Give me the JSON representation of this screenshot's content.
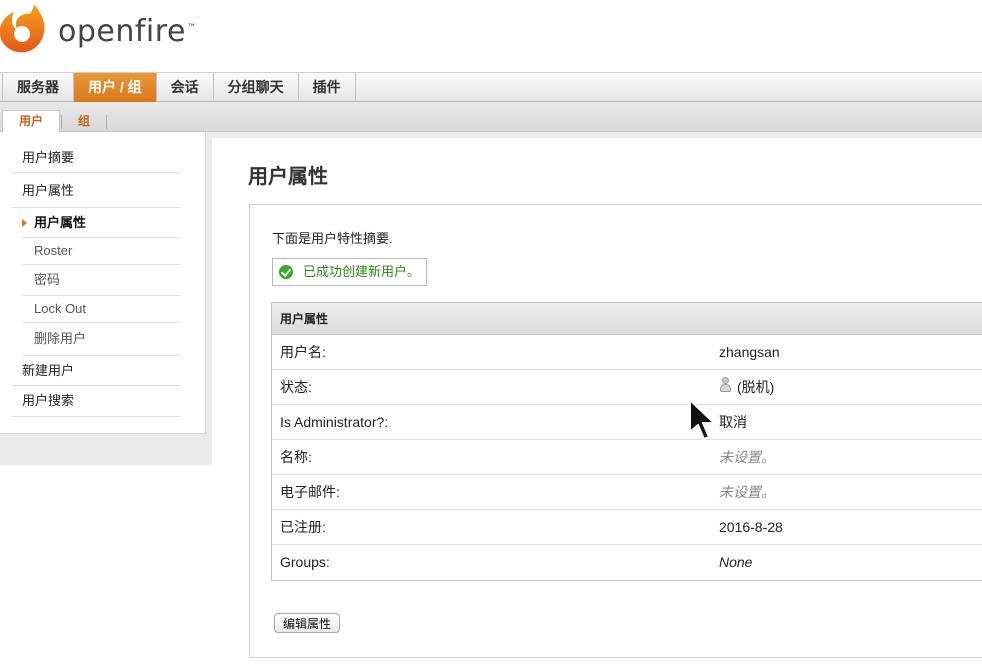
{
  "brand": {
    "name": "openfire",
    "tm": "™"
  },
  "main_nav": [
    {
      "label": "服务器",
      "active": false
    },
    {
      "label": "用户 / 组",
      "active": true
    },
    {
      "label": "会话",
      "active": false
    },
    {
      "label": "分组聊天",
      "active": false
    },
    {
      "label": "插件",
      "active": false
    }
  ],
  "sub_nav": [
    {
      "label": "用户",
      "active": true
    },
    {
      "label": "组",
      "active": false
    }
  ],
  "sidebar": {
    "items": [
      {
        "label": "用户摘要"
      },
      {
        "label": "用户属性"
      },
      {
        "label": "用户属性"
      },
      {
        "label": "Roster"
      },
      {
        "label": "密码"
      },
      {
        "label": "Lock Out"
      },
      {
        "label": "删除用户"
      },
      {
        "label": "新建用户"
      },
      {
        "label": "用户搜索"
      }
    ]
  },
  "main": {
    "title": "用户属性",
    "intro": "下面是用户特性摘要.",
    "success_message": "已成功创建新用户。",
    "table_header": "用户属性",
    "rows": [
      {
        "label": "用户名:",
        "value": "zhangsan"
      },
      {
        "label": "状态:",
        "value": "(脱机)"
      },
      {
        "label": "Is Administrator?:",
        "value": "取消"
      },
      {
        "label": "名称:",
        "value": "未设置。"
      },
      {
        "label": "电子邮件:",
        "value": "未设置。"
      },
      {
        "label": "已注册:",
        "value": "2016-8-28"
      },
      {
        "label": "Groups:",
        "value": "None"
      }
    ],
    "edit_button": "编辑属性"
  },
  "colors": {
    "accent": "#d9781c",
    "success": "#2a8a18"
  }
}
